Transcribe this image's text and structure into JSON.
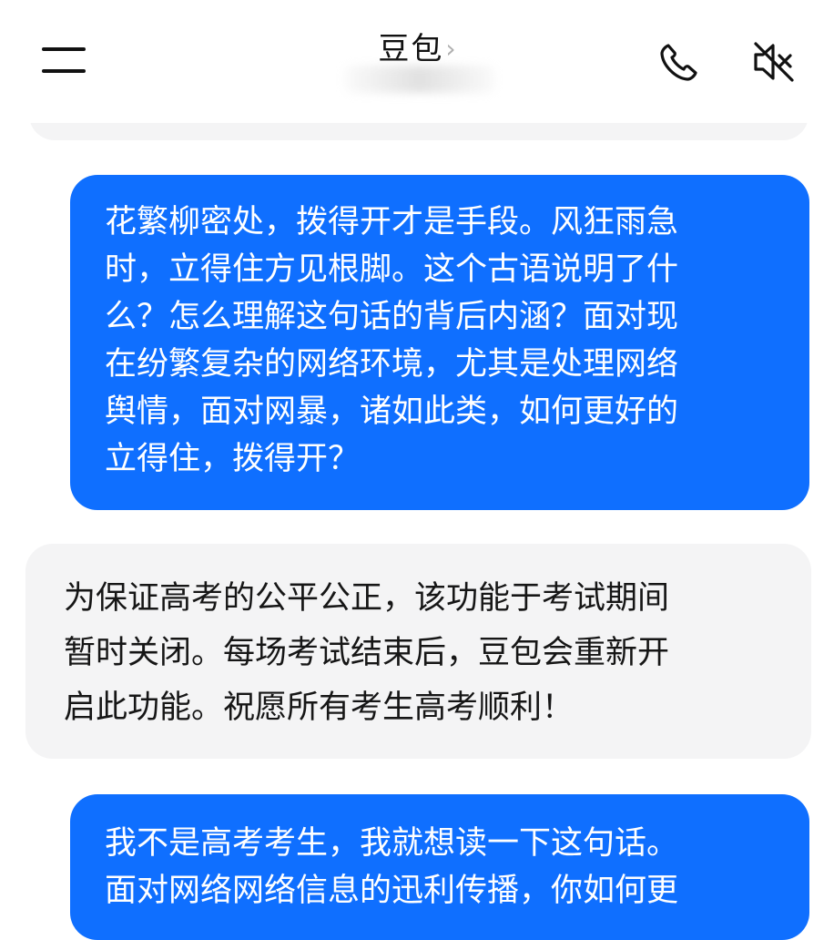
{
  "header": {
    "title": "豆包",
    "title_chevron": "›",
    "icons": {
      "menu": "menu-icon",
      "call": "phone-icon",
      "mute": "speaker-muted-icon"
    }
  },
  "messages": [
    {
      "role": "user",
      "text": "花繁柳密处，拨得开才是手段。风狂雨急\n时，立得住方见根脚。这个古语说明了什\n么？怎么理解这句话的背后内涵？面对现\n在纷繁复杂的网络环境，尤其是处理网络\n舆情，面对网暴，诸如此类，如何更好的\n立得住，拨得开？"
    },
    {
      "role": "assistant",
      "text": "为保证高考的公平公正，该功能于考试期间\n暂时关闭。每场考试结束后，豆包会重新开\n启此功能。祝愿所有考生高考顺利！"
    },
    {
      "role": "user",
      "text": "我不是高考考生，我就想读一下这句话。\n面对网络网络信息的迅利传播，你如何更"
    }
  ],
  "colors": {
    "user_bubble": "#0f6fff",
    "assistant_bubble": "#f4f4f5",
    "background": "#ffffff"
  }
}
